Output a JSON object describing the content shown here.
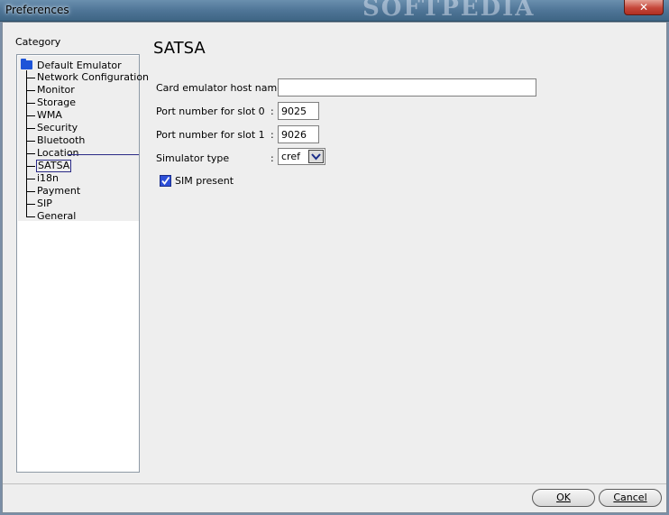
{
  "window": {
    "title": "Preferences",
    "watermark": "SOFTPEDIA"
  },
  "sidebar": {
    "heading": "Category",
    "root": "Default Emulator",
    "items": [
      "Network Configuration",
      "Monitor",
      "Storage",
      "WMA",
      "Security",
      "Bluetooth",
      "Location",
      "SATSA",
      "i18n",
      "Payment",
      "SIP",
      "General"
    ],
    "selected": "SATSA"
  },
  "main": {
    "title": "SATSA",
    "fields": {
      "host": {
        "label": "Card emulator host name",
        "value": ""
      },
      "slot0": {
        "label": "Port number for slot 0",
        "value": "9025"
      },
      "slot1": {
        "label": "Port number for slot 1",
        "value": "9026"
      },
      "sim_type": {
        "label": "Simulator type",
        "value": "cref"
      }
    },
    "colon": ":",
    "sim_present": {
      "label": "SIM present",
      "checked": true
    }
  },
  "buttons": {
    "ok": "OK",
    "cancel": "Cancel"
  },
  "icons": {
    "close": "close-icon",
    "folder": "folder-icon",
    "dropdown": "chevron-down-icon",
    "check": "check-icon"
  }
}
